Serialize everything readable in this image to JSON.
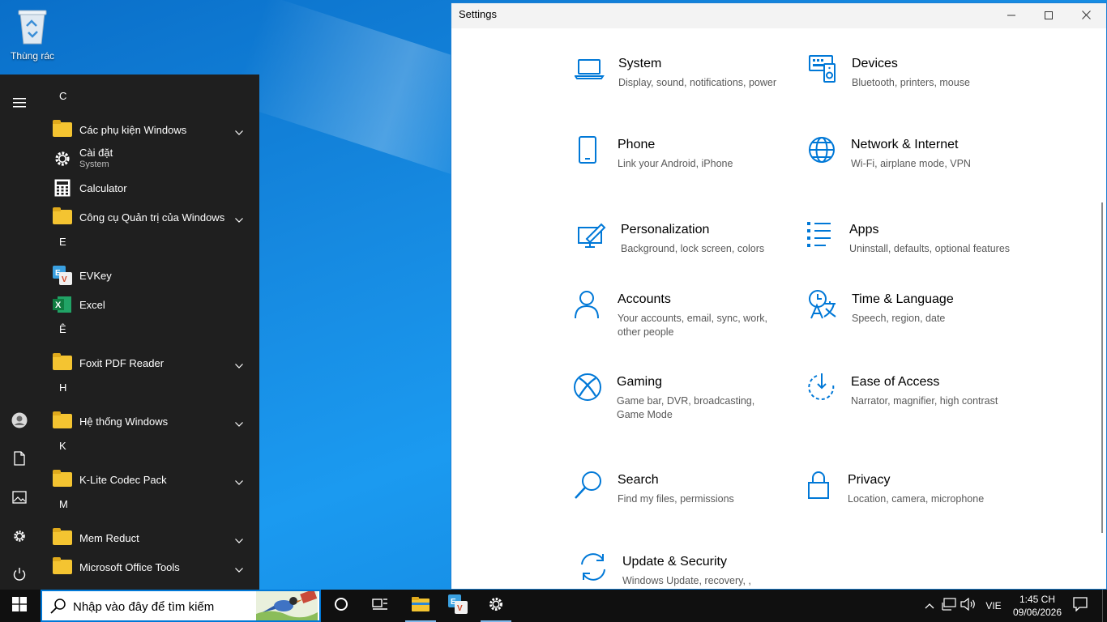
{
  "desktop": {
    "recycle_bin_label": "Thùng rác"
  },
  "start_menu": {
    "groups": [
      {
        "letter": "C",
        "items": [
          {
            "label": "Các phụ kiện Windows",
            "icon": "folder-icon",
            "expandable": true
          },
          {
            "label": "Cài đặt",
            "sub": "System",
            "icon": "gear-icon",
            "expandable": false
          },
          {
            "label": "Calculator",
            "icon": "calculator-icon",
            "expandable": false
          },
          {
            "label": "Công cụ Quản trị của Windows",
            "icon": "folder-icon",
            "expandable": true
          }
        ]
      },
      {
        "letter": "E",
        "items": [
          {
            "label": "EVKey",
            "icon": "evkey-icon",
            "expandable": false
          },
          {
            "label": "Excel",
            "icon": "excel-icon",
            "expandable": false
          }
        ]
      },
      {
        "letter": "Ê",
        "items": [
          {
            "label": "Foxit PDF Reader",
            "icon": "folder-icon",
            "expandable": true
          }
        ]
      },
      {
        "letter": "H",
        "items": [
          {
            "label": "Hệ thống Windows",
            "icon": "folder-icon",
            "expandable": true
          }
        ]
      },
      {
        "letter": "K",
        "items": [
          {
            "label": "K-Lite Codec Pack",
            "icon": "folder-icon",
            "expandable": true
          }
        ]
      },
      {
        "letter": "M",
        "items": [
          {
            "label": "Mem Reduct",
            "icon": "folder-icon",
            "expandable": true
          },
          {
            "label": "Microsoft Office Tools",
            "icon": "folder-icon",
            "expandable": true
          }
        ]
      }
    ]
  },
  "settings": {
    "title": "Settings",
    "accent": "#0078d7",
    "tiles": [
      {
        "name": "System",
        "desc": "Display, sound, notifications, power",
        "icon": "laptop-icon"
      },
      {
        "name": "Devices",
        "desc": "Bluetooth, printers, mouse",
        "icon": "keyboard-speaker-icon"
      },
      {
        "name": "Phone",
        "desc": "Link your Android, iPhone",
        "icon": "phone-icon"
      },
      {
        "name": "Network & Internet",
        "desc": "Wi-Fi, airplane mode, VPN",
        "icon": "globe-icon"
      },
      {
        "name": "Personalization",
        "desc": "Background, lock screen, colors",
        "icon": "paint-screen-icon"
      },
      {
        "name": "Apps",
        "desc": "Uninstall, defaults, optional features",
        "icon": "apps-list-icon"
      },
      {
        "name": "Accounts",
        "desc": "Your accounts, email, sync, work, other people",
        "icon": "person-icon"
      },
      {
        "name": "Time & Language",
        "desc": "Speech, region, date",
        "icon": "time-language-icon"
      },
      {
        "name": "Gaming",
        "desc": "Game bar, DVR, broadcasting, Game Mode",
        "icon": "xbox-icon"
      },
      {
        "name": "Ease of Access",
        "desc": "Narrator, magnifier, high contrast",
        "icon": "ease-of-access-icon"
      },
      {
        "name": "Search",
        "desc": "Find my files, permissions",
        "icon": "magnifier-icon"
      },
      {
        "name": "Privacy",
        "desc": "Location, camera, microphone",
        "icon": "lock-icon"
      },
      {
        "name": "Update & Security",
        "desc": "Windows Update, recovery, ,",
        "icon": "sync-icon"
      }
    ]
  },
  "taskbar": {
    "search_placeholder": "Nhập vào đây để tìm kiếm",
    "language": "VIE",
    "time": "1:45 CH",
    "date": "09/06/2026"
  }
}
